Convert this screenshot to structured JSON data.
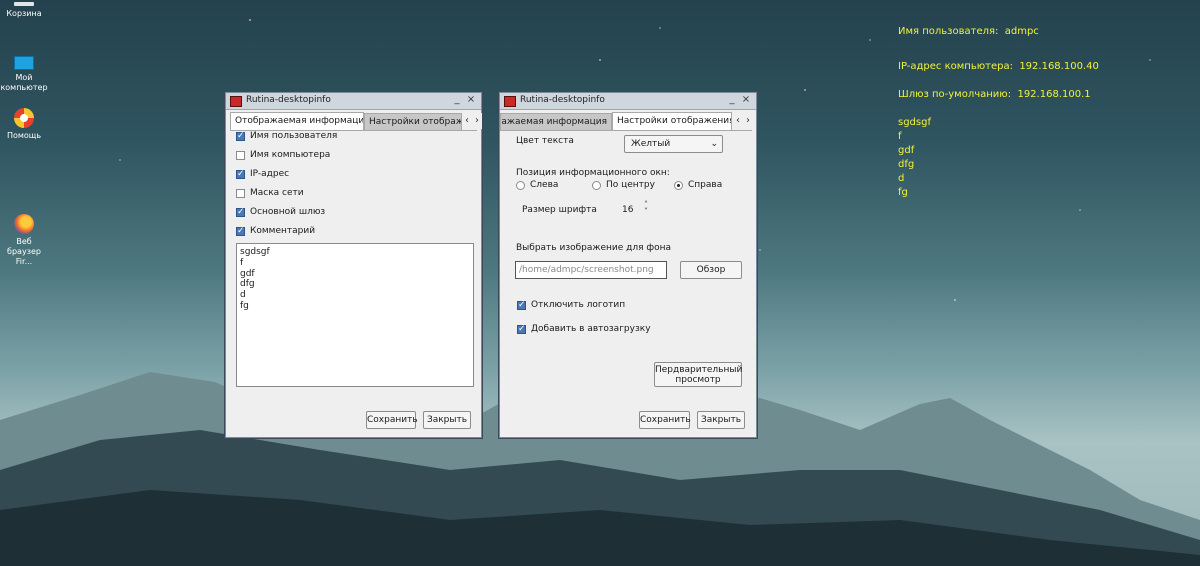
{
  "desktop": {
    "icons": [
      {
        "label": "Корзина"
      },
      {
        "label": "Мой компьютер"
      },
      {
        "label": "Помощь"
      },
      {
        "label": "Веб браузер Fir..."
      }
    ]
  },
  "overlay": {
    "username_line": "Имя пользователя:  admpc",
    "ip_line": "IP-адрес компьютера:  192.168.100.40",
    "gateway_line": "Шлюз по-умолчанию:  192.168.100.1",
    "comment_lines": [
      "sgdsgf",
      "f",
      "gdf",
      "dfg",
      "d",
      "fg"
    ],
    "text_color": "#f2f23c"
  },
  "window1": {
    "title": "Rutina-desktopinfo",
    "tabs": [
      "Отображаемая информация",
      "Настройки отображения"
    ],
    "checkboxes": [
      {
        "label": "Имя пользователя",
        "checked": true
      },
      {
        "label": "Имя компьютера",
        "checked": false
      },
      {
        "label": "IP-адрес",
        "checked": true
      },
      {
        "label": "Маска сети",
        "checked": false
      },
      {
        "label": "Основной шлюз",
        "checked": true
      },
      {
        "label": "Комментарий",
        "checked": true
      }
    ],
    "comment_lines": [
      "sgdsgf",
      "f",
      "gdf",
      "dfg",
      "d",
      "fg"
    ],
    "save_label": "Сохранить",
    "close_label": "Закрыть"
  },
  "window2": {
    "title": "Rutina-desktopinfo",
    "tabs": [
      "Отображаемая информация",
      "Настройки отображения"
    ],
    "text_color_label": "Цвет текста",
    "text_color_value": "Желтый",
    "position_label": "Позиция информационного окн:",
    "position_options": [
      {
        "label": "Слева",
        "selected": false
      },
      {
        "label": "По центру",
        "selected": false
      },
      {
        "label": "Справа",
        "selected": true
      }
    ],
    "font_size_label": "Размер шрифта",
    "font_size_value": "16",
    "bg_label": "Выбрать изображение для фона",
    "bg_path": "/home/admpc/screenshot.png",
    "browse_label": "Обзор",
    "disable_logo_label": "Отключить логотип",
    "autostart_label": "Добавить в автозагрузку",
    "preview_label_1": "Пердварительный",
    "preview_label_2": "просмотр",
    "save_label": "Сохранить",
    "close_label": "Закрыть"
  }
}
